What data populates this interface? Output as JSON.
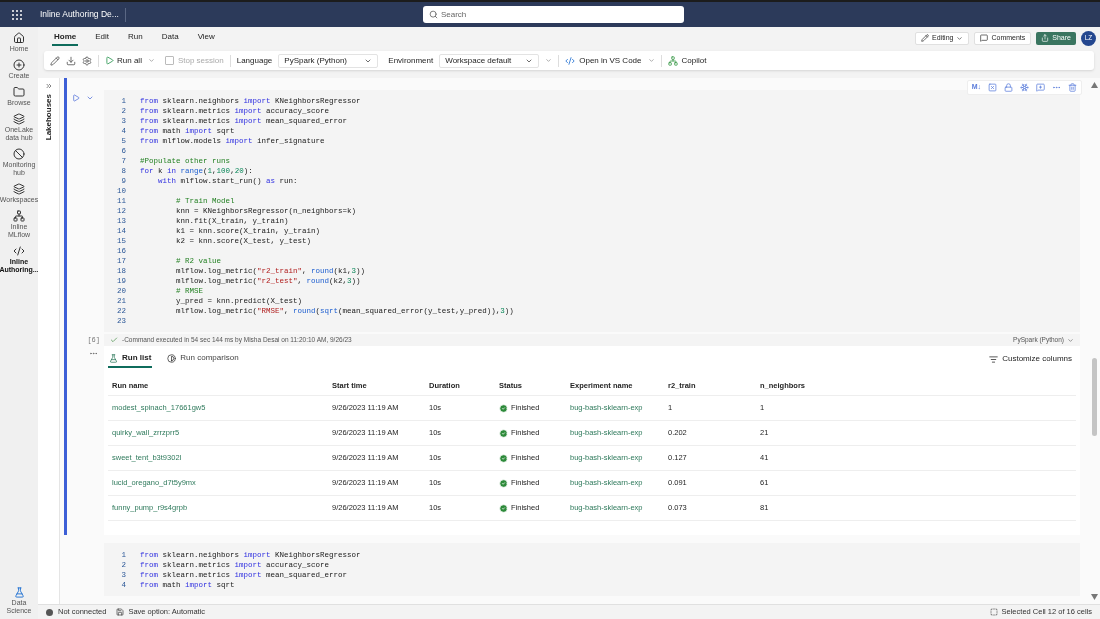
{
  "app": {
    "title": "Inline Authoring De...",
    "search": {
      "placeholder": "Search"
    }
  },
  "ribbon": {
    "tabs": [
      {
        "label": "Home",
        "selected": true
      },
      {
        "label": "Edit",
        "selected": false
      },
      {
        "label": "Run",
        "selected": false
      },
      {
        "label": "Data",
        "selected": false
      },
      {
        "label": "View",
        "selected": false
      }
    ],
    "actions": {
      "editing": "Editing",
      "comments": "Comments",
      "share": "Share",
      "avatar": "LZ"
    }
  },
  "toolbar": {
    "run_all": "Run all",
    "stop_session": {
      "label": "Stop session",
      "disabled": true
    },
    "language_label": "Language",
    "language": "PySpark (Python)",
    "environment_label": "Environment",
    "environment": "Workspace default",
    "vscode": "Open in VS Code",
    "copilot": "Copilot"
  },
  "nav": [
    {
      "label": "Home",
      "selected": false
    },
    {
      "label": "Create",
      "selected": false
    },
    {
      "label": "Browse",
      "selected": false
    },
    {
      "label": "OneLake data hub",
      "selected": false
    },
    {
      "label": "Monitoring hub",
      "selected": false
    },
    {
      "label": "Workspaces",
      "selected": false
    },
    {
      "label": "Inline MLflow",
      "selected": false
    },
    {
      "label": "Inline Authoring...",
      "selected": true
    }
  ],
  "nav_footer": {
    "label": "Data Science"
  },
  "side_panel": {
    "label": "Lakehouses"
  },
  "cell_toolbar": {
    "markdown": "M↓"
  },
  "code_cell": {
    "lines": [
      {
        "number": "1",
        "tokens": [
          {
            "text": "from",
            "kind": "kw"
          },
          {
            "text": " sklearn.neighbors ",
            "kind": "plain"
          },
          {
            "text": "import",
            "kind": "kw"
          },
          {
            "text": " KNeighborsRegressor",
            "kind": "plain"
          }
        ]
      },
      {
        "number": "2",
        "tokens": [
          {
            "text": "from",
            "kind": "kw"
          },
          {
            "text": " sklearn.metrics ",
            "kind": "plain"
          },
          {
            "text": "import",
            "kind": "kw"
          },
          {
            "text": " accuracy_score",
            "kind": "plain"
          }
        ]
      },
      {
        "number": "3",
        "tokens": [
          {
            "text": "from",
            "kind": "kw"
          },
          {
            "text": " sklearn.metrics ",
            "kind": "plain"
          },
          {
            "text": "import",
            "kind": "kw"
          },
          {
            "text": " mean_squared_error",
            "kind": "plain"
          }
        ]
      },
      {
        "number": "4",
        "tokens": [
          {
            "text": "from",
            "kind": "kw"
          },
          {
            "text": " math ",
            "kind": "plain"
          },
          {
            "text": "import",
            "kind": "kw"
          },
          {
            "text": " sqrt",
            "kind": "plain"
          }
        ]
      },
      {
        "number": "5",
        "tokens": [
          {
            "text": "from",
            "kind": "kw"
          },
          {
            "text": " mlflow.models ",
            "kind": "plain"
          },
          {
            "text": "import",
            "kind": "kw"
          },
          {
            "text": " infer_signature",
            "kind": "plain"
          }
        ]
      },
      {
        "number": "6"
      },
      {
        "number": "7",
        "tokens": [
          {
            "text": "#Populate other runs",
            "kind": "comment"
          }
        ]
      },
      {
        "number": "8",
        "tokens": [
          {
            "text": "for",
            "kind": "kw"
          },
          {
            "text": " k ",
            "kind": "plain"
          },
          {
            "text": "in",
            "kind": "kw"
          },
          {
            "text": " range",
            "kind": "fn"
          },
          {
            "text": "(",
            "kind": "plain"
          },
          {
            "text": "1",
            "kind": "num"
          },
          {
            "text": ",",
            "kind": "plain"
          },
          {
            "text": "100",
            "kind": "num"
          },
          {
            "text": ",",
            "kind": "plain"
          },
          {
            "text": "20",
            "kind": "num"
          },
          {
            "text": "):",
            "kind": "plain"
          }
        ]
      },
      {
        "number": "9",
        "tokens": [
          {
            "text": "    with",
            "kind": "kw"
          },
          {
            "text": " mlflow.start_run() ",
            "kind": "plain"
          },
          {
            "text": "as",
            "kind": "kw"
          },
          {
            "text": " run:",
            "kind": "plain"
          }
        ]
      },
      {
        "number": "10"
      },
      {
        "number": "11",
        "tokens": [
          {
            "text": "        # Train Model",
            "kind": "comment"
          }
        ]
      },
      {
        "number": "12",
        "tokens": [
          {
            "text": "        knn = KNeighborsRegressor(n_neighbors=k)",
            "kind": "plain"
          }
        ]
      },
      {
        "number": "13",
        "tokens": [
          {
            "text": "        knn.fit(X_train, y_train)",
            "kind": "plain"
          }
        ]
      },
      {
        "number": "14",
        "tokens": [
          {
            "text": "        k1 = knn.score(X_train, y_train)",
            "kind": "plain"
          }
        ]
      },
      {
        "number": "15",
        "tokens": [
          {
            "text": "        k2 = knn.score(X_test, y_test)",
            "kind": "plain"
          }
        ]
      },
      {
        "number": "16"
      },
      {
        "number": "17",
        "tokens": [
          {
            "text": "        # R2 value",
            "kind": "comment"
          }
        ]
      },
      {
        "number": "18",
        "tokens": [
          {
            "text": "        mlflow.log_metric(",
            "kind": "plain"
          },
          {
            "text": "\"r2_train\"",
            "kind": "str"
          },
          {
            "text": ", ",
            "kind": "plain"
          },
          {
            "text": "round",
            "kind": "fn"
          },
          {
            "text": "(k1,",
            "kind": "plain"
          },
          {
            "text": "3",
            "kind": "num"
          },
          {
            "text": "))",
            "kind": "plain"
          }
        ]
      },
      {
        "number": "19",
        "tokens": [
          {
            "text": "        mlflow.log_metric(",
            "kind": "plain"
          },
          {
            "text": "\"r2_test\"",
            "kind": "str"
          },
          {
            "text": ", ",
            "kind": "plain"
          },
          {
            "text": "round",
            "kind": "fn"
          },
          {
            "text": "(k2,",
            "kind": "plain"
          },
          {
            "text": "3",
            "kind": "num"
          },
          {
            "text": "))",
            "kind": "plain"
          }
        ]
      },
      {
        "number": "20",
        "tokens": [
          {
            "text": "        # RMSE",
            "kind": "comment"
          }
        ]
      },
      {
        "number": "21",
        "tokens": [
          {
            "text": "        y_pred = knn.predict(X_test)",
            "kind": "plain"
          }
        ]
      },
      {
        "number": "22",
        "tokens": [
          {
            "text": "        mlflow.log_metric(",
            "kind": "plain"
          },
          {
            "text": "\"RMSE\"",
            "kind": "str"
          },
          {
            "text": ", ",
            "kind": "plain"
          },
          {
            "text": "round",
            "kind": "fn"
          },
          {
            "text": "(",
            "kind": "plain"
          },
          {
            "text": "sqrt",
            "kind": "fn"
          },
          {
            "text": "(mean_squared_error(y_test,y_pred)),",
            "kind": "plain"
          },
          {
            "text": "3",
            "kind": "num"
          },
          {
            "text": "))",
            "kind": "plain"
          }
        ]
      },
      {
        "number": "23"
      }
    ],
    "execution_count": "[6]",
    "status": "-Command executed in 54 sec 144 ms by Misha Desai on 11:20:10 AM, 9/26/23",
    "language": "PySpark (Python)"
  },
  "output": {
    "tabs": [
      {
        "label": "Run list",
        "selected": true
      },
      {
        "label": "Run comparison",
        "selected": false
      }
    ],
    "customize": "Customize columns",
    "table": {
      "columns": [
        "Run name",
        "Start time",
        "Duration",
        "Status",
        "Experiment name",
        "r2_train",
        "n_neighbors"
      ],
      "rows": [
        {
          "run_name": "modest_spinach_17661gw5",
          "start_time": "9/26/2023 11:19 AM",
          "duration": "10s",
          "status": "Finished",
          "experiment": "bug-bash-sklearn-exp",
          "r2_train": "1",
          "n_neighbors": "1"
        },
        {
          "run_name": "quirky_wall_zrrzprr5",
          "start_time": "9/26/2023 11:19 AM",
          "duration": "10s",
          "status": "Finished",
          "experiment": "bug-bash-sklearn-exp",
          "r2_train": "0.202",
          "n_neighbors": "21"
        },
        {
          "run_name": "sweet_tent_b3t9302l",
          "start_time": "9/26/2023 11:19 AM",
          "duration": "10s",
          "status": "Finished",
          "experiment": "bug-bash-sklearn-exp",
          "r2_train": "0.127",
          "n_neighbors": "41"
        },
        {
          "run_name": "lucid_oregano_d7t5y9mx",
          "start_time": "9/26/2023 11:19 AM",
          "duration": "10s",
          "status": "Finished",
          "experiment": "bug-bash-sklearn-exp",
          "r2_train": "0.091",
          "n_neighbors": "61"
        },
        {
          "run_name": "funny_pump_r9s4grpb",
          "start_time": "9/26/2023 11:19 AM",
          "duration": "10s",
          "status": "Finished",
          "experiment": "bug-bash-sklearn-exp",
          "r2_train": "0.073",
          "n_neighbors": "81"
        }
      ]
    }
  },
  "next_cell": {
    "lines": [
      {
        "number": "1",
        "tokens": [
          {
            "text": "from",
            "kind": "kw"
          },
          {
            "text": " sklearn.neighbors ",
            "kind": "plain"
          },
          {
            "text": "import",
            "kind": "kw"
          },
          {
            "text": " KNeighborsRegressor",
            "kind": "plain"
          }
        ]
      },
      {
        "number": "2",
        "tokens": [
          {
            "text": "from",
            "kind": "kw"
          },
          {
            "text": " sklearn.metrics ",
            "kind": "plain"
          },
          {
            "text": "import",
            "kind": "kw"
          },
          {
            "text": " accuracy_score",
            "kind": "plain"
          }
        ]
      },
      {
        "number": "3",
        "tokens": [
          {
            "text": "from",
            "kind": "kw"
          },
          {
            "text": " sklearn.metrics ",
            "kind": "plain"
          },
          {
            "text": "import",
            "kind": "kw"
          },
          {
            "text": " mean_squared_error",
            "kind": "plain"
          }
        ]
      },
      {
        "number": "4",
        "tokens": [
          {
            "text": "from",
            "kind": "kw"
          },
          {
            "text": " math ",
            "kind": "plain"
          },
          {
            "text": "import",
            "kind": "kw"
          },
          {
            "text": " sqrt",
            "kind": "plain"
          }
        ]
      }
    ]
  },
  "status_bar": {
    "connection": "Not connected",
    "save": "Save option: Automatic",
    "selection": "Selected Cell 12 of 16 cells"
  }
}
